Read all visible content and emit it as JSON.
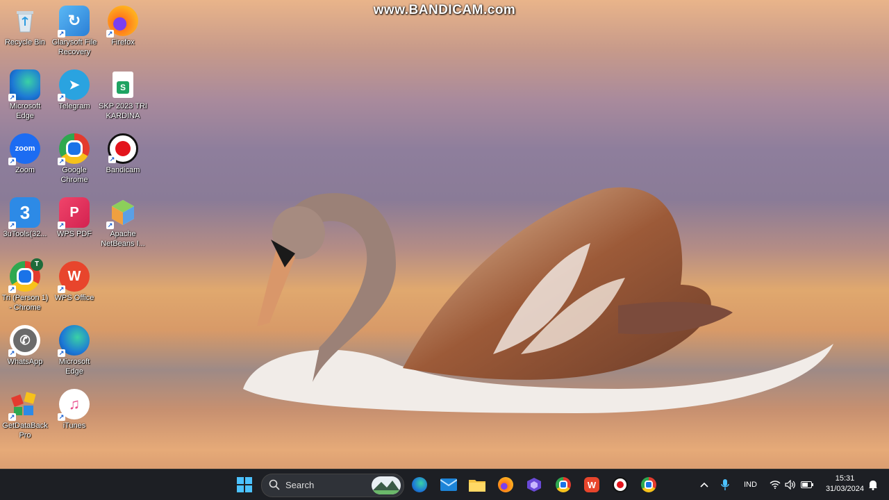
{
  "watermark": "www.BANDICAM.com",
  "desktop_icons": [
    {
      "label": "Recycle Bin"
    },
    {
      "label": "Glarysoft File Recovery"
    },
    {
      "label": "Firefox"
    },
    {
      "label": "Microsoft Edge"
    },
    {
      "label": "Telegram"
    },
    {
      "label": "SKP 2023 TRI KARDINA"
    },
    {
      "label": "Zoom"
    },
    {
      "label": "Google Chrome"
    },
    {
      "label": "Bandicam"
    },
    {
      "label": "3uTools(32..."
    },
    {
      "label": "WPS PDF"
    },
    {
      "label": "Apache NetBeans I..."
    },
    {
      "label": "Tri (Person 1) - Chrome"
    },
    {
      "label": "WPS Office"
    },
    {
      "label": "WhatsApp"
    },
    {
      "label": "Microsoft Edge"
    },
    {
      "label": "GetDataBack Pro"
    },
    {
      "label": "iTunes"
    }
  ],
  "icon_glyphs": {
    "zoom": "zoom",
    "telegram": "➤",
    "skp": "S",
    "wpspdf": "P",
    "wps": "W",
    "threeu": "3",
    "tri": "T"
  },
  "taskbar": {
    "search_placeholder": "Search",
    "tray_language": "IND",
    "clock_time": "15:31",
    "clock_date": "31/03/2024"
  },
  "colors": {
    "taskbar_bg": "#1d1f24",
    "accent": "#0a7cd8"
  }
}
